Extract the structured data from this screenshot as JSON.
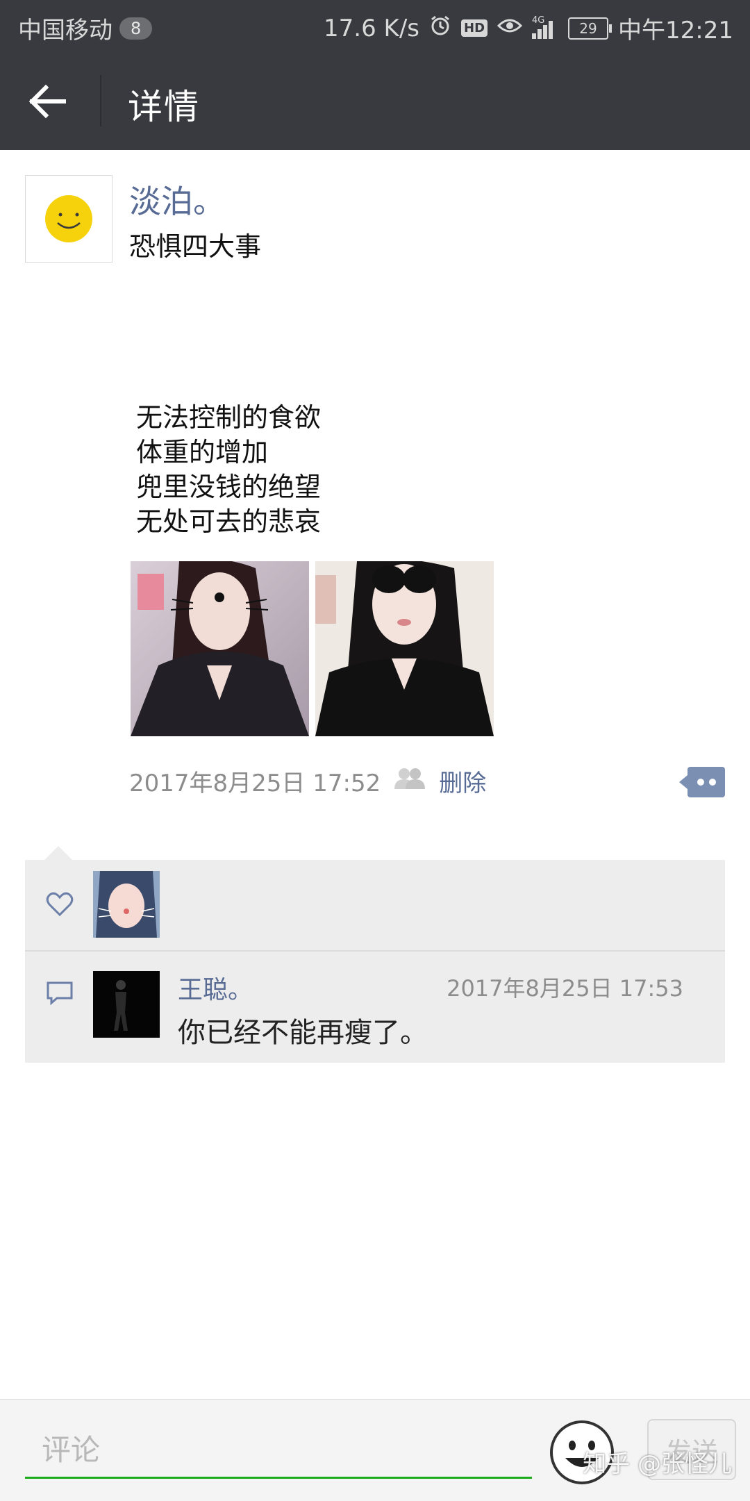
{
  "status_bar": {
    "carrier": "中国移动",
    "notification_count": "8",
    "net_speed": "17.6 K/s",
    "network_type": "4G",
    "battery": "29",
    "time": "中午12:21"
  },
  "header": {
    "title": "详情"
  },
  "post": {
    "author": "淡泊。",
    "title": "恐惧四大事",
    "lines": [
      "无法控制的食欲",
      "体重的增加",
      "兜里没钱的绝望",
      "无处可去的悲哀"
    ],
    "timestamp": "2017年8月25日 17:52",
    "delete_label": "删除"
  },
  "comment": {
    "author": "王聪。",
    "time": "2017年8月25日 17:53",
    "text": "你已经不能再瘦了。"
  },
  "input": {
    "placeholder": "评论",
    "send_label": "发送"
  },
  "watermark": "知乎 @张怪儿",
  "colors": {
    "header_bg": "#393a3f",
    "link": "#576b95",
    "accent_green": "#1aad19",
    "panel_bg": "#ededed"
  }
}
